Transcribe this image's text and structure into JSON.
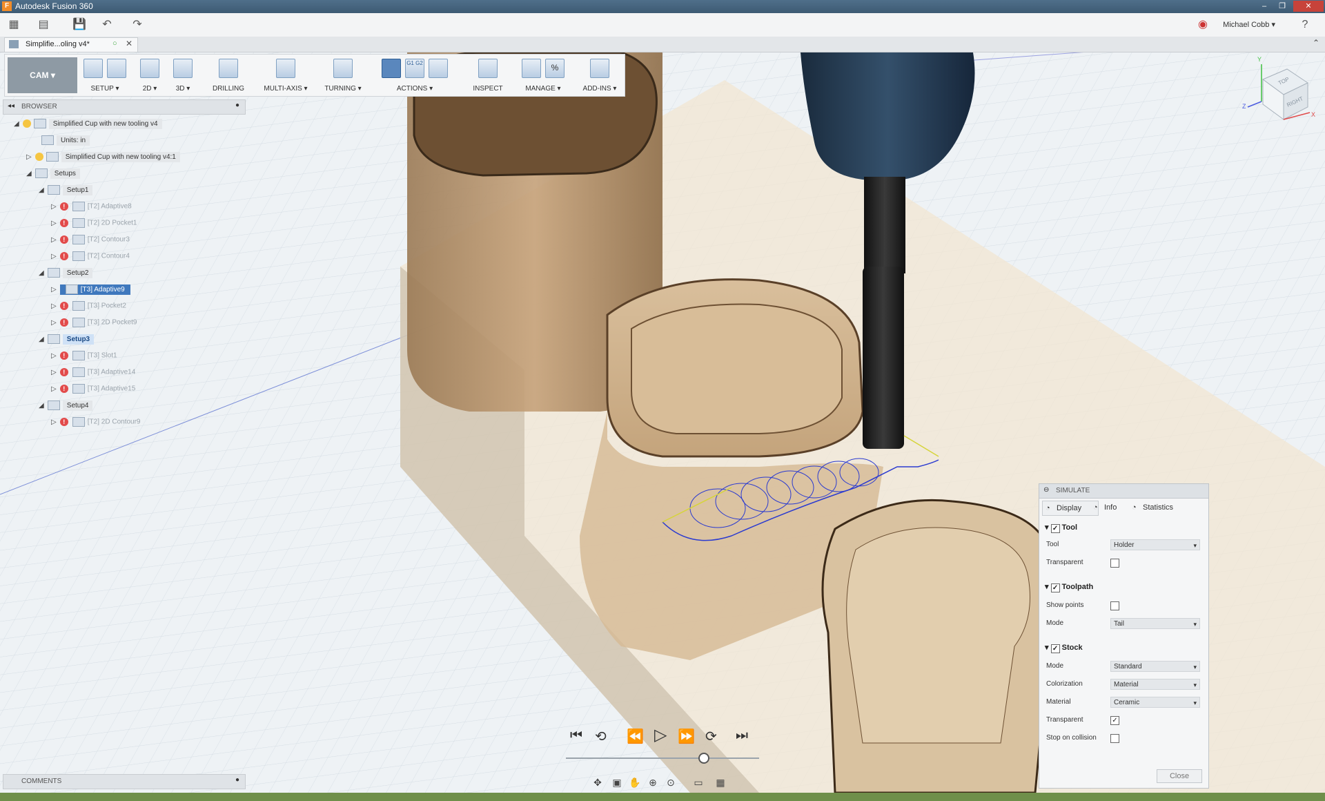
{
  "window": {
    "title": "Autodesk Fusion 360",
    "app_icon": "F"
  },
  "quick_access": {
    "user": "Michael Cobb",
    "help": "?"
  },
  "document": {
    "tab_title": "Simplifie...oling v4*"
  },
  "ribbon": {
    "workspace": "CAM",
    "groups": [
      {
        "label": "SETUP"
      },
      {
        "label": "2D"
      },
      {
        "label": "3D"
      },
      {
        "label": "DRILLING"
      },
      {
        "label": "MULTI-AXIS"
      },
      {
        "label": "TURNING"
      },
      {
        "label": "ACTIONS"
      },
      {
        "label": "INSPECT"
      },
      {
        "label": "MANAGE"
      },
      {
        "label": "ADD-INS"
      }
    ],
    "g1g2": "G1 G2",
    "percent": "%"
  },
  "browser": {
    "title": "BROWSER",
    "root": "Simplified Cup with new tooling v4",
    "units": "Units: in",
    "component": "Simplified Cup with new tooling v4:1",
    "setups": "Setups",
    "setup1": {
      "label": "Setup1",
      "ops": [
        "[T2] Adaptive8",
        "[T2] 2D Pocket1",
        "[T2] Contour3",
        "[T2] Contour4"
      ]
    },
    "setup2": {
      "label": "Setup2",
      "ops": [
        "[T3] Adaptive9",
        "[T3] Pocket2",
        "[T3] 2D Pocket9"
      ]
    },
    "setup3": {
      "label": "Setup3",
      "ops": [
        "[T3] Slot1",
        "[T3] Adaptive14",
        "[T3] Adaptive15"
      ]
    },
    "setup4": {
      "label": "Setup4",
      "ops": [
        "[T2] 2D Contour9"
      ]
    }
  },
  "comments": {
    "title": "COMMENTS"
  },
  "viewcube": {
    "top": "TOP",
    "right": "RIGHT",
    "axis_y": "Y",
    "axis_z": "Z",
    "axis_x": "X"
  },
  "simulate": {
    "title": "SIMULATE",
    "tabs": [
      "Display",
      "Info",
      "Statistics"
    ],
    "tool_section": "Tool",
    "tool_label": "Tool",
    "tool_value": "Holder",
    "transparent_label": "Transparent",
    "toolpath_section": "Toolpath",
    "show_points_label": "Show points",
    "mode_label": "Mode",
    "toolpath_mode": "Tail",
    "stock_section": "Stock",
    "stock_mode": "Standard",
    "colorization_label": "Colorization",
    "colorization_value": "Material",
    "material_label": "Material",
    "material_value": "Ceramic",
    "stock_transparent_label": "Transparent",
    "stop_on_collision_label": "Stop on collision",
    "close_label": "Close",
    "checked": {
      "tool": true,
      "tool_transparent": false,
      "toolpath": true,
      "show_points": false,
      "stock": true,
      "stock_transparent": true,
      "stop_on_collision": false
    }
  }
}
